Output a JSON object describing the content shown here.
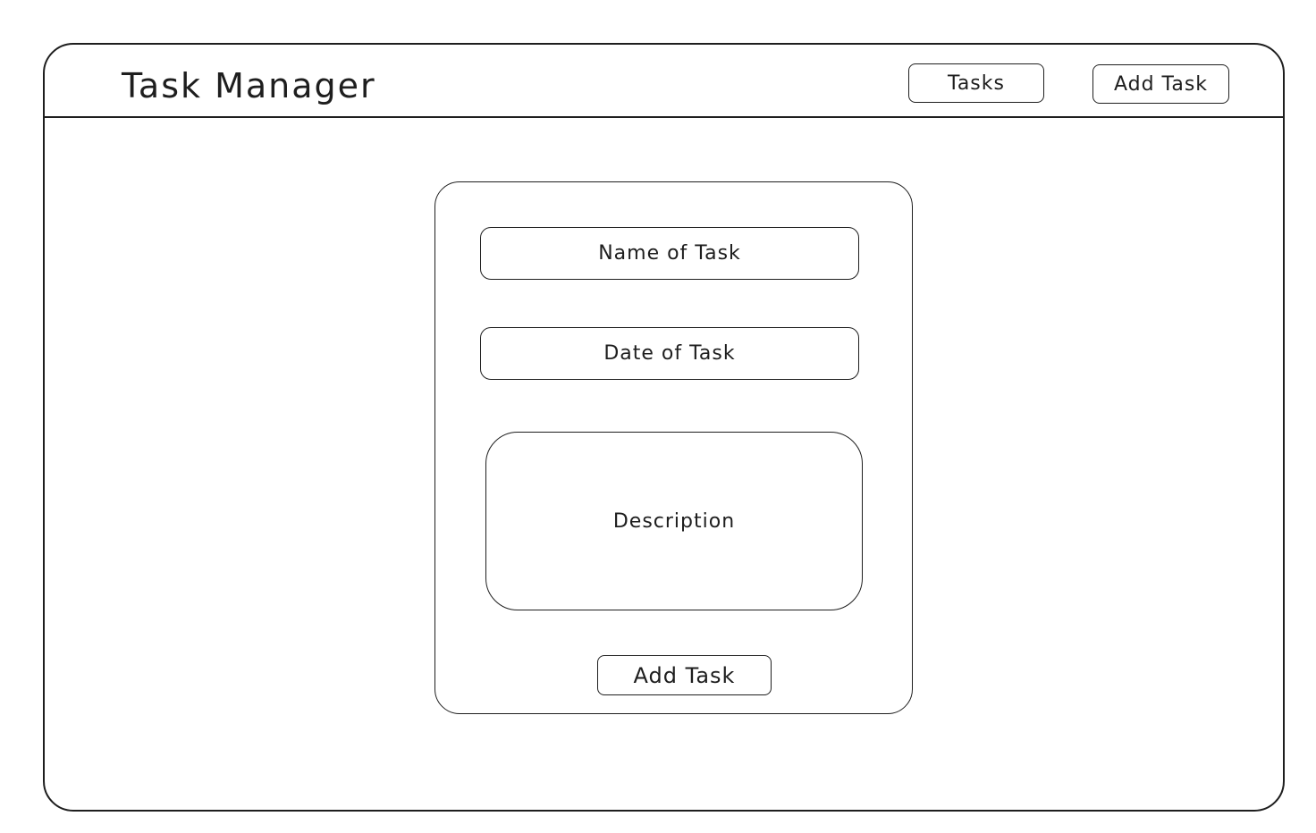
{
  "header": {
    "title": "Task Manager",
    "nav": {
      "tasks_label": "Tasks",
      "add_task_label": "Add Task"
    }
  },
  "form": {
    "name_placeholder": "Name of Task",
    "date_placeholder": "Date of Task",
    "description_placeholder": "Description",
    "submit_label": "Add Task"
  }
}
